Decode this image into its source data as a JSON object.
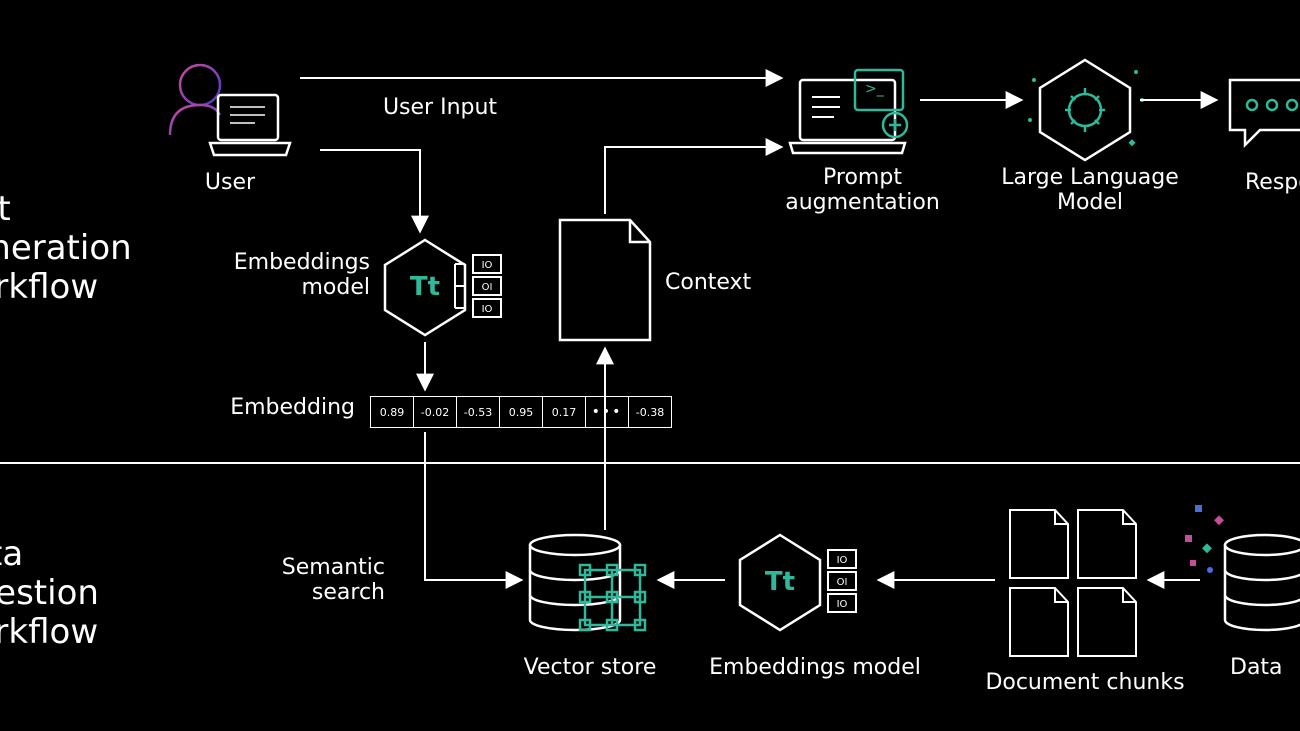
{
  "sections": {
    "text_generation": "Text\nGeneration\nWorkflow",
    "data_ingestion": "Data\nIngestion\nWorkflow"
  },
  "nodes": {
    "user": "User",
    "user_input": "User Input",
    "embeddings_model_top": "Embeddings\nmodel",
    "embedding": "Embedding",
    "context": "Context",
    "prompt_aug": "Prompt\naugmentation",
    "llm": "Large Language\nModel",
    "response": "Response",
    "semantic_search": "Semantic\nsearch",
    "vector_store": "Vector store",
    "embeddings_model_bottom": "Embeddings model",
    "document_chunks": "Document chunks",
    "data": "Data"
  },
  "embedding_values": [
    "0.89",
    "-0.02",
    "-0.53",
    "0.95",
    "0.17",
    "•••",
    "-0.38"
  ],
  "colors": {
    "accent_teal": "#2fb89a",
    "grad_a": "#c94b9b",
    "grad_b": "#4b3cc9",
    "white": "#ffffff"
  }
}
